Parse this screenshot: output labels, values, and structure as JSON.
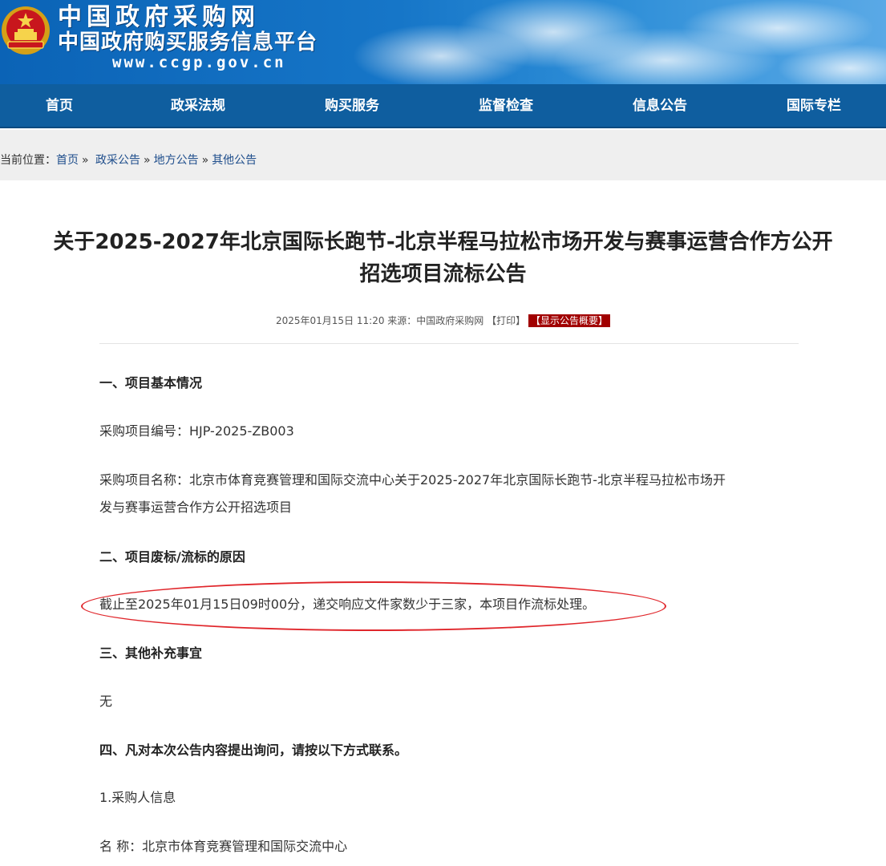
{
  "header": {
    "site_title": "中国政府采购网",
    "site_subtitle": "中国政府购买服务信息平台",
    "site_url": "www.ccgp.gov.cn"
  },
  "nav": {
    "items": [
      {
        "label": "首页"
      },
      {
        "label": "政采法规"
      },
      {
        "label": "购买服务"
      },
      {
        "label": "监督检查"
      },
      {
        "label": "信息公告"
      },
      {
        "label": "国际专栏"
      }
    ]
  },
  "breadcrumb": {
    "prefix": "当前位置：",
    "items": [
      "首页",
      "政采公告",
      "地方公告",
      "其他公告"
    ],
    "separator": "»"
  },
  "article": {
    "title_line1": "关于2025-2027年北京国际长跑节-北京半程马拉松市场开发与赛事运营合作方公开",
    "title_line2": "招选项目流标公告",
    "meta_date": "2025年01月15日 11:20",
    "meta_source": "来源：中国政府采购网",
    "print_label": "【打印】",
    "summary_label": "【显示公告概要】",
    "sections": [
      {
        "heading": "一、项目基本情况"
      },
      {
        "text": "采购项目编号：HJP-2025-ZB003"
      },
      {
        "text_line1": "采购项目名称：北京市体育竞赛管理和国际交流中心关于2025-2027年北京国际长跑节-北京半程马拉松市场开",
        "text_line2": "发与赛事运营合作方公开招选项目"
      },
      {
        "heading": "二、项目废标/流标的原因"
      },
      {
        "text": "截止至2025年01月15日09时00分，递交响应文件家数少于三家，本项目作流标处理。"
      },
      {
        "heading": "三、其他补充事宜"
      },
      {
        "text": "无"
      },
      {
        "heading": "四、凡对本次公告内容提出询问，请按以下方式联系。"
      },
      {
        "text": "1.采购人信息"
      },
      {
        "text": "名 称：北京市体育竞赛管理和国际交流中心"
      }
    ]
  },
  "colors": {
    "nav_bg": "#0f5e9f",
    "highlight": "#e0262b",
    "summary_btn": "#a10000"
  }
}
